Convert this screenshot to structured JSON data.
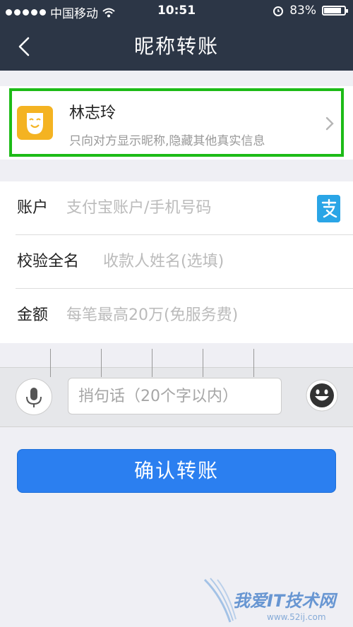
{
  "status_bar": {
    "carrier": "中国移动",
    "time": "10:51",
    "battery": "83%"
  },
  "nav": {
    "title": "昵称转账"
  },
  "nickname_card": {
    "name": "林志玲",
    "description": "只向对方显示昵称,隐藏其他真实信息"
  },
  "form": {
    "account_label": "账户",
    "account_placeholder": "支付宝账户/手机号码",
    "name_label": "校验全名",
    "name_placeholder": "收款人姓名(选填)",
    "amount_label": "金额",
    "amount_placeholder": "每笔最高20万(免服务费)"
  },
  "message": {
    "placeholder": "捎句话（20个字以内）"
  },
  "confirm_button": "确认转账",
  "watermark": {
    "text": "我爱IT技术网",
    "url": "www.52ij.com"
  },
  "colors": {
    "nav_bg": "#2c3646",
    "highlight": "#1dbb17",
    "primary": "#2b7ff0",
    "mask_icon": "#f4b322"
  },
  "icons": [
    "signal-dots-icon",
    "wifi-icon",
    "alarm-icon",
    "battery-icon",
    "back-icon",
    "mask-icon",
    "chevron-right-icon",
    "alipay-icon",
    "microphone-icon",
    "emoji-icon"
  ]
}
